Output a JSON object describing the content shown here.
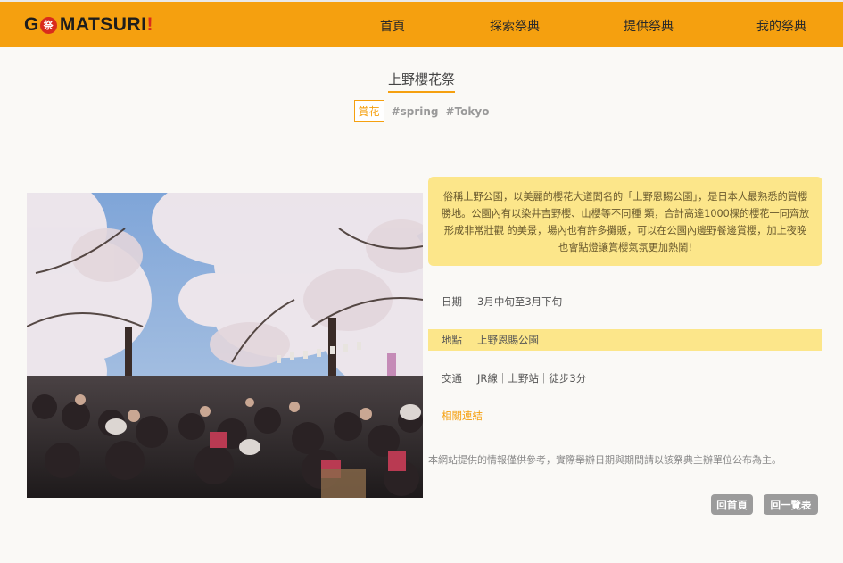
{
  "brand": {
    "logo_prefix": "G",
    "logo_seal": "祭",
    "logo_suffix": "MATSURI",
    "logo_bang": "!"
  },
  "nav": {
    "items": [
      {
        "label": "首頁"
      },
      {
        "label": "探索祭典"
      },
      {
        "label": "提供祭典"
      },
      {
        "label": "我的祭典"
      }
    ]
  },
  "festival": {
    "title": "上野櫻花祭",
    "category_tag": "賞花",
    "hashtags": [
      "#spring",
      "#Tokyo"
    ],
    "description": "俗稱上野公園，以美麗的櫻花大道聞名的「上野恩賜公園」，是日本人最熟悉的賞櫻勝地。公園內有以染井吉野櫻、山櫻等不同種 類，合計高達1000棵的櫻花一同齊放形成非常壯觀 的美景，場內也有許多攤販，可以在公園內邊野餐邊賞櫻，加上夜晚也會點燈讓賞櫻氣氛更加熱鬧!",
    "info": [
      {
        "key": "日期",
        "value": "3月中旬至3月下旬"
      },
      {
        "key": "地點",
        "value": "上野恩賜公園"
      },
      {
        "key": "交通",
        "value": "JR線｜上野站｜徒步3分"
      }
    ],
    "related_link": "相關連結",
    "disclaimer": "本網站提供的情報僅供參考，實際舉辦日期與期間請以該祭典主辦單位公布為主。"
  },
  "actions": {
    "home_button": "回首頁",
    "list_button": "回一覽表"
  },
  "colors": {
    "accent": "#f5a00f",
    "highlight": "#fce68a",
    "button": "#9b9b9b",
    "seal": "#d92b1c"
  }
}
